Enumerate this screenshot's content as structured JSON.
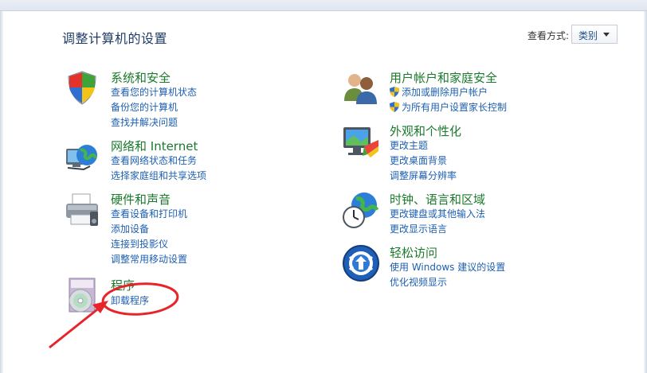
{
  "page_title": "调整计算机的设置",
  "view_by": {
    "label": "查看方式:",
    "selected": "类别"
  },
  "categories": {
    "system_security": {
      "title": "系统和安全",
      "links": [
        "查看您的计算机状态",
        "备份您的计算机",
        "查找并解决问题"
      ]
    },
    "network": {
      "title": "网络和 Internet",
      "links": [
        "查看网络状态和任务",
        "选择家庭组和共享选项"
      ]
    },
    "hardware": {
      "title": "硬件和声音",
      "links": [
        "查看设备和打印机",
        "添加设备",
        "连接到投影仪",
        "调整常用移动设置"
      ]
    },
    "programs": {
      "title": "程序",
      "links": [
        "卸载程序"
      ]
    },
    "user_accounts": {
      "title": "用户帐户和家庭安全",
      "links": [
        "添加或删除用户帐户",
        "为所有用户设置家长控制"
      ]
    },
    "appearance": {
      "title": "外观和个性化",
      "links": [
        "更改主题",
        "更改桌面背景",
        "调整屏幕分辨率"
      ]
    },
    "clock": {
      "title": "时钟、语言和区域",
      "links": [
        "更改键盘或其他输入法",
        "更改显示语言"
      ]
    },
    "ease": {
      "title": "轻松访问",
      "links": [
        "使用 Windows 建议的设置",
        "优化视频显示"
      ]
    }
  },
  "colors": {
    "title_blue": "#1f3b66",
    "category_green": "#1a7a2c",
    "link_blue": "#1d5fb0",
    "annotation_red": "#e8242a"
  }
}
